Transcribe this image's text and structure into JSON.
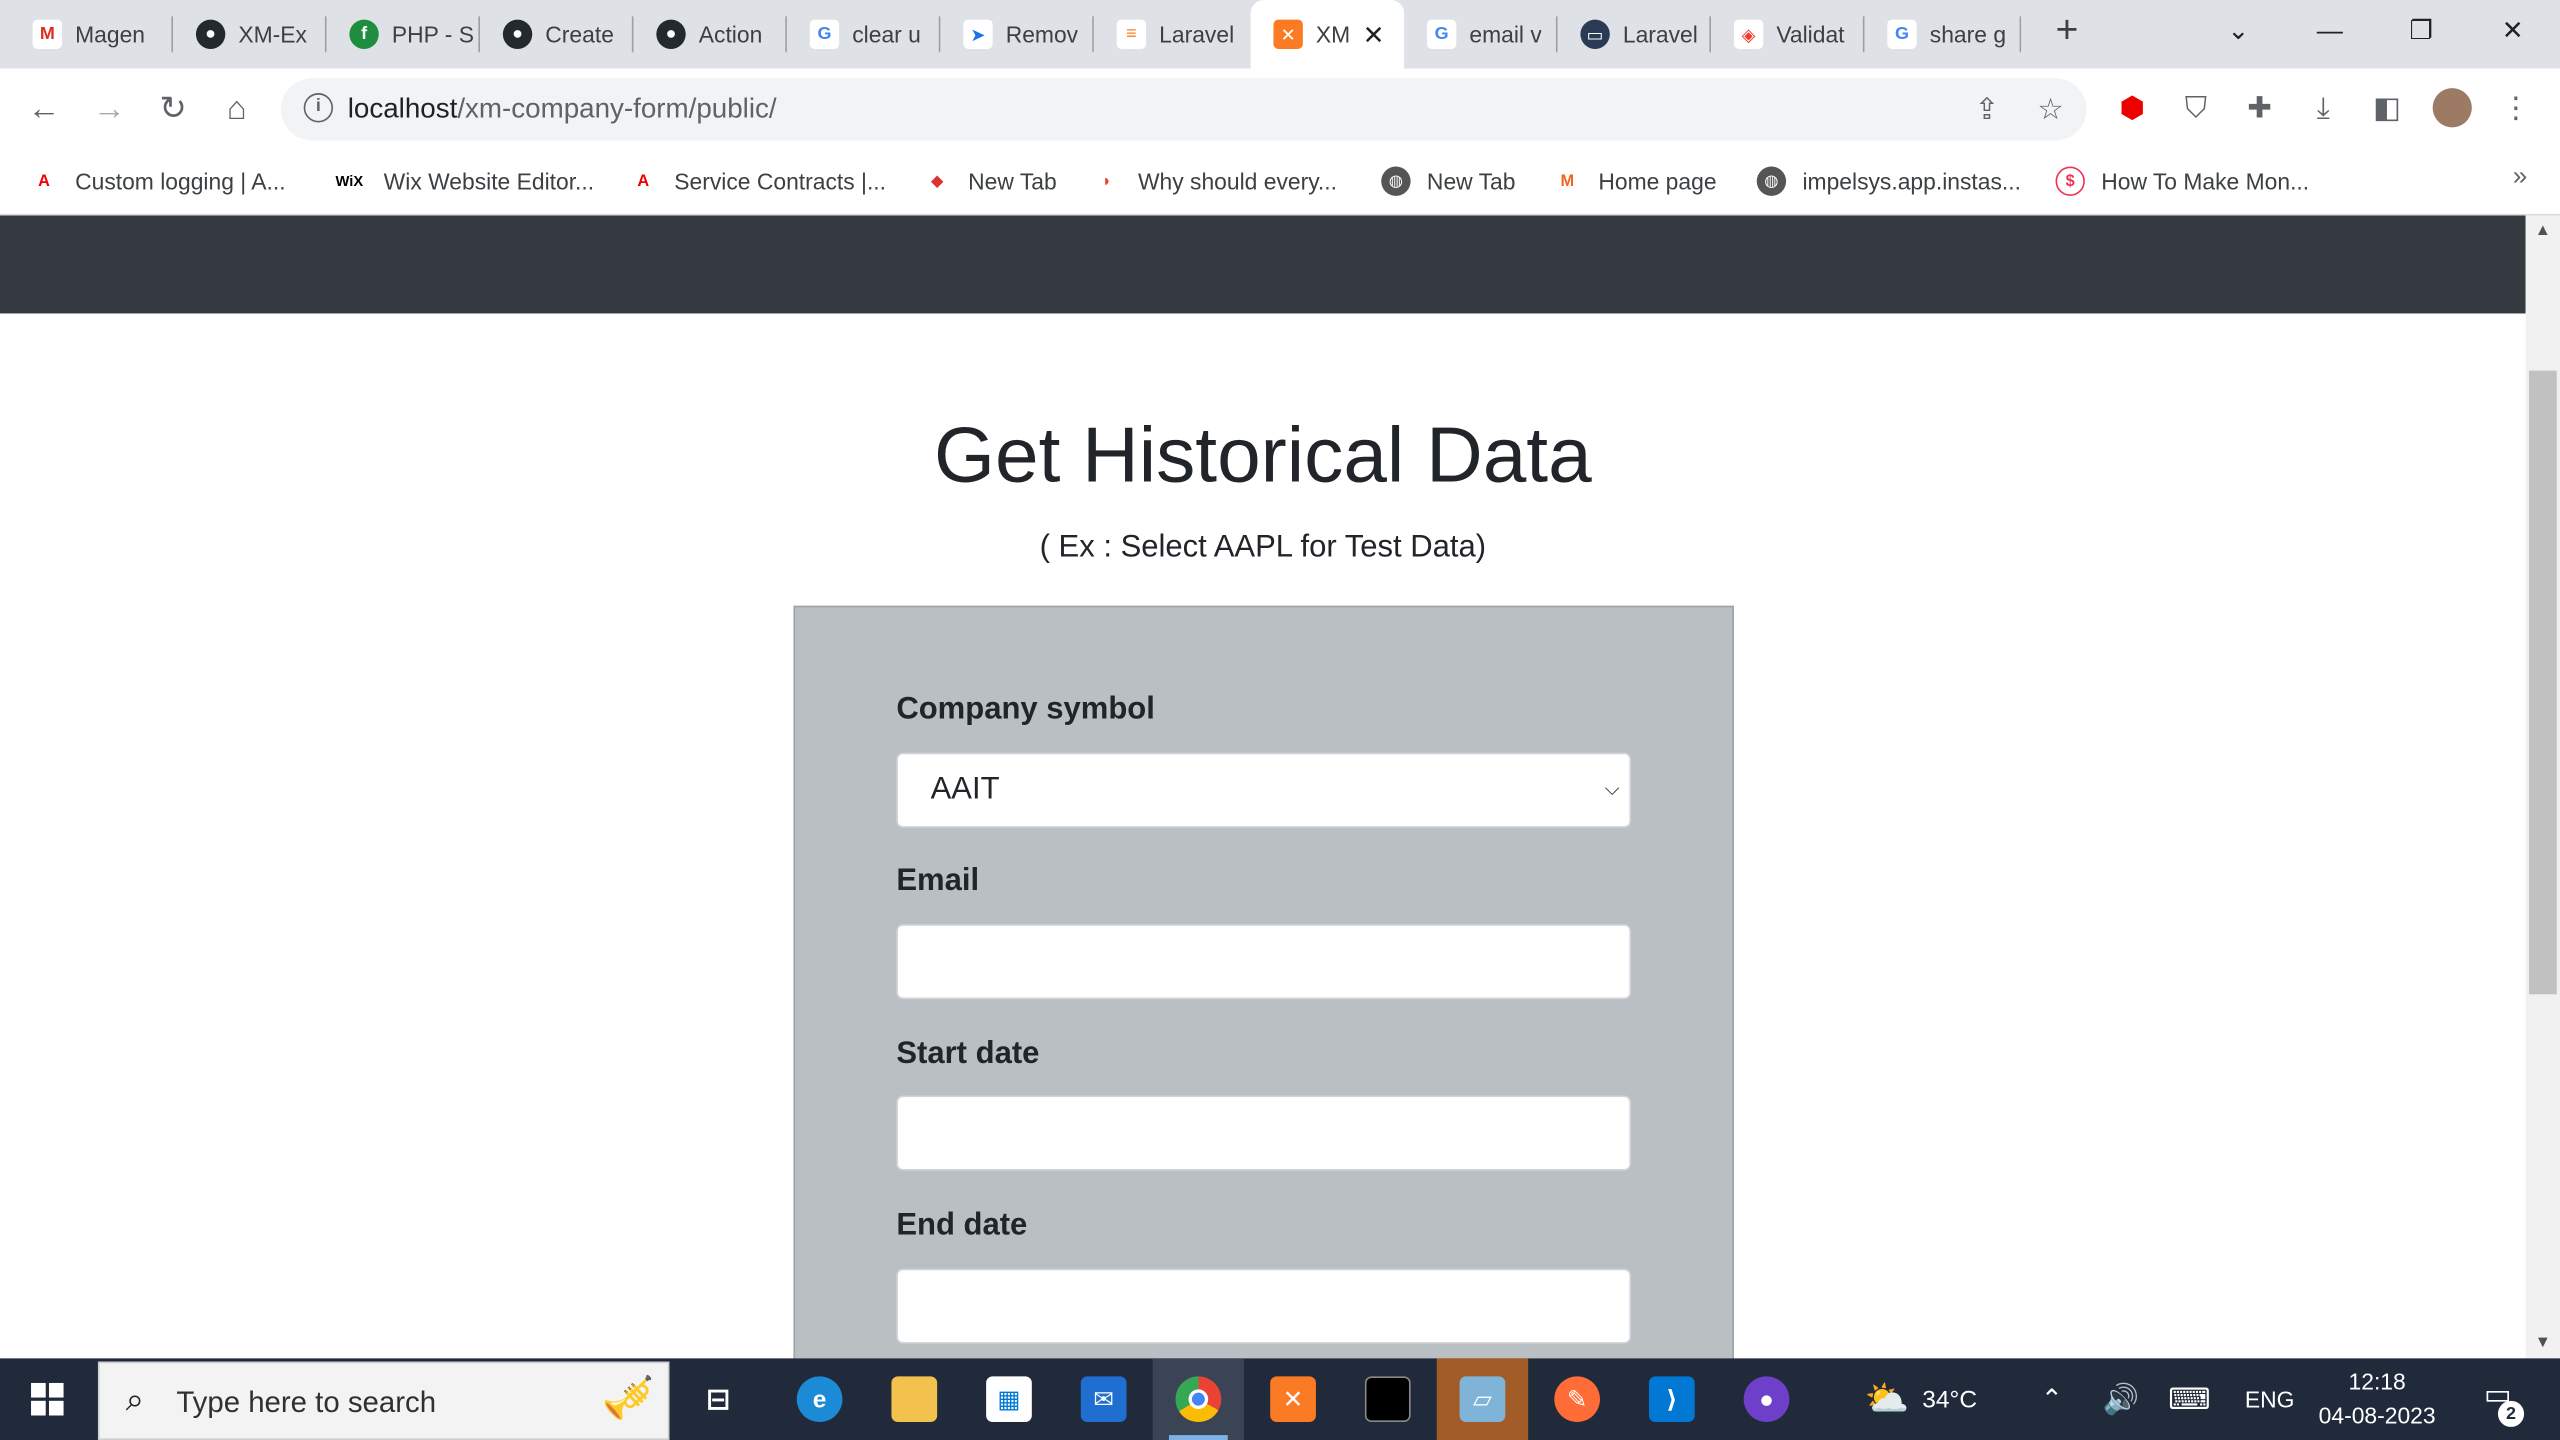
{
  "tabs": [
    {
      "label": "Magen",
      "icon": "gmail-icon"
    },
    {
      "label": "XM-Ex",
      "icon": "github-icon"
    },
    {
      "label": "PHP - S",
      "icon": "php-icon"
    },
    {
      "label": "Create",
      "icon": "github-icon"
    },
    {
      "label": "Action",
      "icon": "github-icon"
    },
    {
      "label": "clear u",
      "icon": "google-icon"
    },
    {
      "label": "Remov",
      "icon": "send-icon"
    },
    {
      "label": "Laravel",
      "icon": "stackoverflow-icon"
    },
    {
      "label": "XM",
      "icon": "xampp-icon"
    },
    {
      "label": "email v",
      "icon": "google-icon"
    },
    {
      "label": "Laravel",
      "icon": "laptop-icon"
    },
    {
      "label": "Validat",
      "icon": "laravel-icon"
    },
    {
      "label": "share g",
      "icon": "google-icon"
    }
  ],
  "active_tab_close": "✕",
  "new_tab": "+",
  "address": {
    "host": "localhost",
    "path": "/xm-company-form/public/"
  },
  "bookmarks": [
    {
      "label": "Custom logging | A..."
    },
    {
      "label": "Wix Website Editor..."
    },
    {
      "label": "Service Contracts |..."
    },
    {
      "label": "New Tab"
    },
    {
      "label": "Why should every..."
    },
    {
      "label": "New Tab"
    },
    {
      "label": "Home page"
    },
    {
      "label": "impelsys.app.instas..."
    },
    {
      "label": "How To Make Mon..."
    }
  ],
  "bookmark_more": "»",
  "page": {
    "title": "Get Historical Data",
    "subtitle": "( Ex : Select AAPL for Test Data)",
    "form": {
      "company_label": "Company symbol",
      "company_value": "AAIT",
      "email_label": "Email",
      "email_value": "",
      "start_label": "Start date",
      "start_value": "",
      "end_label": "End date",
      "end_value": ""
    }
  },
  "taskbar": {
    "search_placeholder": "Type here to search",
    "weather": "34°C",
    "language": "ENG",
    "time": "12:18",
    "date": "04-08-2023",
    "notifications": "2"
  },
  "colors": {
    "navbar": "#343a40",
    "form_bg": "#babfc3",
    "taskbar": "#202a3a"
  }
}
